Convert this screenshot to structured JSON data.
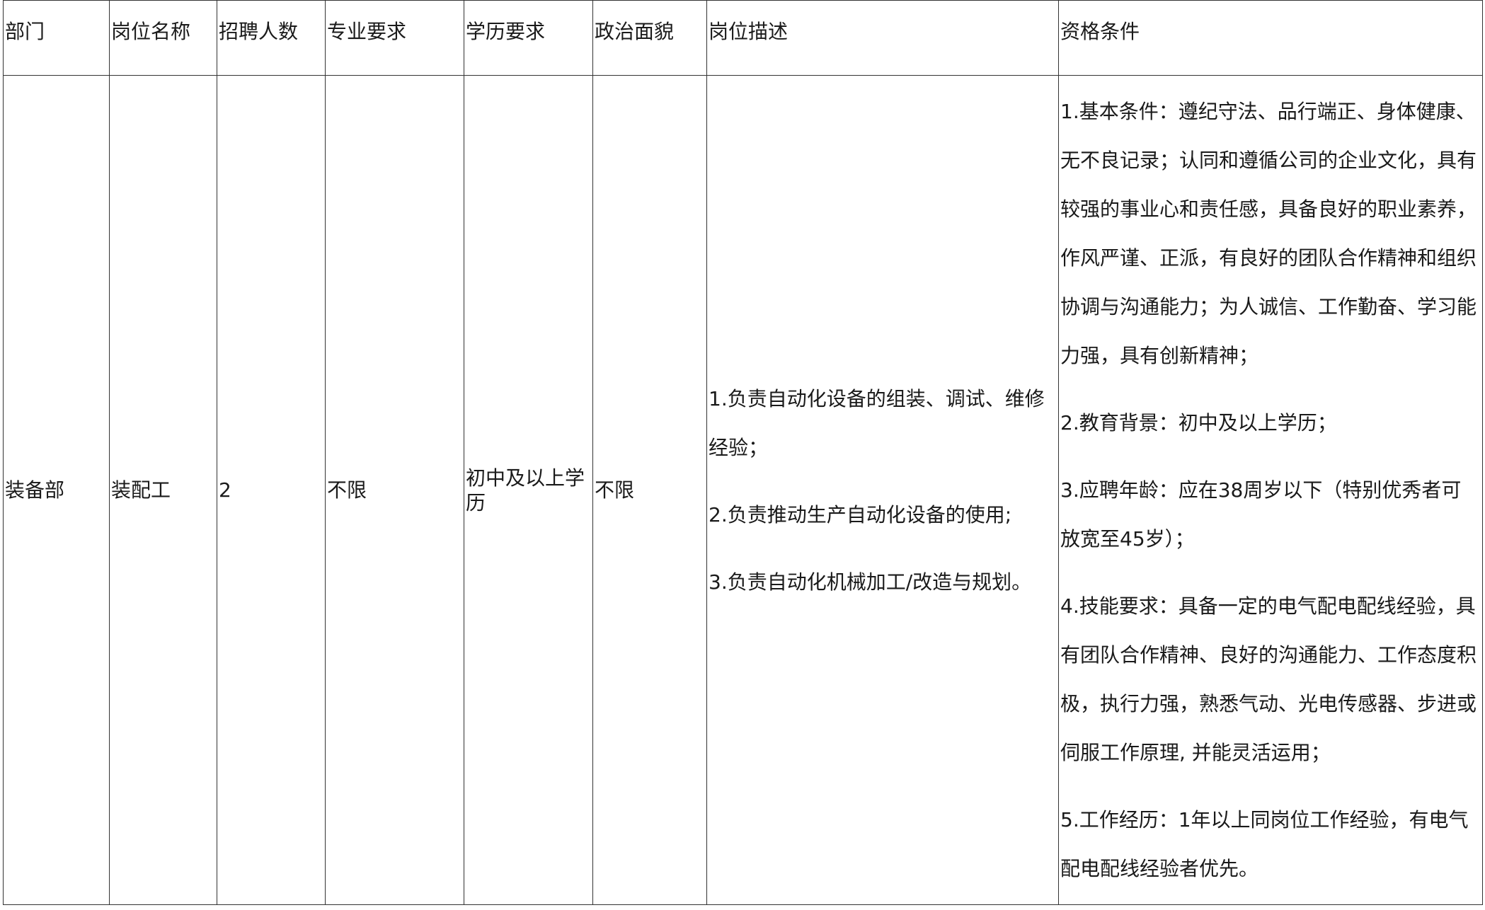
{
  "table": {
    "headers": [
      "部门",
      "岗位名称",
      "招聘人数",
      "专业要求",
      "学历要求",
      "政治面貌",
      "岗位描述",
      "资格条件"
    ],
    "row": {
      "department": "装备部",
      "position": "装配工",
      "count": "2",
      "major": "不限",
      "education": "初中及以上学历",
      "political_status": "不限",
      "description": [
        "1.负责自动化设备的组装、调试、维修经验；",
        "2.负责推动生产自动化设备的使用;",
        "3.负责自动化机械加工/改造与规划。"
      ],
      "qualifications": [
        "1.基本条件：遵纪守法、品行端正、身体健康、无不良记录；认同和遵循公司的企业文化，具有较强的事业心和责任感，具备良好的职业素养，作风严谨、正派，有良好的团队合作精神和组织协调与沟通能力；为人诚信、工作勤奋、学习能力强，具有创新精神；",
        "2.教育背景：初中及以上学历；",
        "3.应聘年龄：应在38周岁以下（特别优秀者可放宽至45岁）；",
        "4.技能要求：具备一定的电气配电配线经验，具有团队合作精神、良好的沟通能力、工作态度积极，执行力强，熟悉气动、光电传感器、步进或伺服工作原理, 并能灵活运用；",
        "5.工作经历：1年以上同岗位工作经验，有电气配电配线经验者优先。"
      ]
    }
  }
}
